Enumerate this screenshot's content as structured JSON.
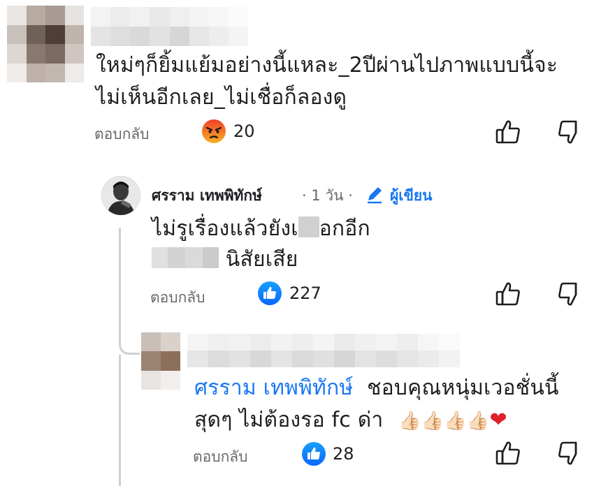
{
  "comments": [
    {
      "text_line1": "ใหม่ๆก็ยิ้มแย้มอย่างนี้แหละ_2ปีผ่านไปภาพแบบนี้จะ",
      "text_line2": "ไม่เห็นอีกเลย_ไม่เชื่อก็ลองดู",
      "reply_label": "ตอบกลับ",
      "reaction_icon": "angry-emoji",
      "reaction_count": "20"
    },
    {
      "author": "ศรราม เทพพิทักษ์",
      "time": "· 1 วัน ·",
      "author_badge": "ผู้เขียน",
      "text_line1_a": "ไม่รูเรื่องแล้วยังเ",
      "text_line1_b": "อกอีก",
      "text_line2": "นิสัยเสีย",
      "reply_label": "ตอบกลับ",
      "reaction_icon": "like-icon",
      "reaction_count": "227"
    },
    {
      "mention": "ศรราม เทพพิทักษ์",
      "text_line1": "ชอบคุณหนุ่มเวอชั่นนี้",
      "text_line2": "สุดๆ ไม่ต้องรอ fc ด่า",
      "emojis": "👍🏻👍🏻👍🏻👍🏻",
      "heart": "❤",
      "reply_label": "ตอบกลับ",
      "reaction_icon": "like-icon",
      "reaction_count": "28"
    }
  ],
  "colors": {
    "link": "#1877f2",
    "muted": "#65676b",
    "thread_line": "#ced0d4"
  }
}
